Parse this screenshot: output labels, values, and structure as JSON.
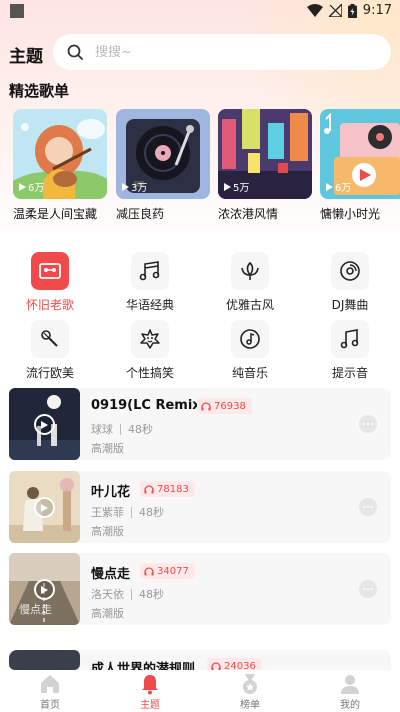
{
  "status_bar": {
    "time": "9:17"
  },
  "header": {
    "title": "主题",
    "search_placeholder": "搜搜~"
  },
  "section": {
    "featured_title": "精选歌单"
  },
  "playlists": [
    {
      "name": "温柔是人间宝藏",
      "plays": "6万",
      "cover": "girl-guitar"
    },
    {
      "name": "减压良药",
      "plays": "3万",
      "cover": "vinyl"
    },
    {
      "name": "浓浓港风情",
      "plays": "5万",
      "cover": "hongkong"
    },
    {
      "name": "慵懒小时光",
      "plays": "6万",
      "cover": "vinyl-orange"
    }
  ],
  "categories": [
    {
      "label": "怀旧老歌",
      "icon": "cassette-icon",
      "active": true
    },
    {
      "label": "华语经典",
      "icon": "music-notes-icon",
      "active": false
    },
    {
      "label": "优雅古风",
      "icon": "lotus-icon",
      "active": false
    },
    {
      "label": "DJ舞曲",
      "icon": "vinyl-icon",
      "active": false
    },
    {
      "label": "流行欧美",
      "icon": "microphone-icon",
      "active": false
    },
    {
      "label": "个性搞笑",
      "icon": "funny-face-icon",
      "active": false
    },
    {
      "label": "纯音乐",
      "icon": "music-disc-icon",
      "active": false
    },
    {
      "label": "提示音",
      "icon": "music-note-icon",
      "active": false
    }
  ],
  "songs": [
    {
      "title": "0919(LC Remix)",
      "listens": "76938",
      "artist": "球球",
      "duration": "48秒",
      "tag": "高潮版"
    },
    {
      "title": "叶儿花",
      "listens": "78183",
      "artist": "王紫菲",
      "duration": "48秒",
      "tag": "高潮版"
    },
    {
      "title": "慢点走",
      "listens": "34077",
      "artist": "洛天依",
      "duration": "48秒",
      "tag": "高潮版"
    },
    {
      "title": "成人世界的潜规则",
      "listens": "24036",
      "artist": "",
      "duration": "",
      "tag": ""
    }
  ],
  "bottom_nav": [
    {
      "label": "首页",
      "icon": "home-icon",
      "active": false
    },
    {
      "label": "主题",
      "icon": "bell-icon",
      "active": true
    },
    {
      "label": "榜单",
      "icon": "medal-icon",
      "active": false
    },
    {
      "label": "我的",
      "icon": "user-icon",
      "active": false
    }
  ],
  "colors": {
    "accent": "#f04a4a",
    "listen_bg": "#fde9e9",
    "card_bg": "#f7f7f7"
  }
}
